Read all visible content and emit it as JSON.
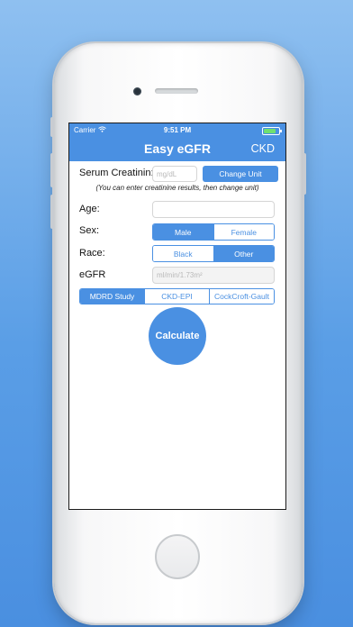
{
  "status_bar": {
    "carrier": "Carrier",
    "time": "9:51 PM"
  },
  "nav": {
    "title": "Easy eGFR",
    "right_button": "CKD"
  },
  "form": {
    "serum_creatinine": {
      "label": "Serum Creatinin:",
      "placeholder": "mg/dL",
      "change_unit": "Change Unit"
    },
    "note": "(You can enter creatinine results, then change unit)",
    "age": {
      "label": "Age:",
      "value": ""
    },
    "sex": {
      "label": "Sex:",
      "options": [
        "Male",
        "Female"
      ],
      "selected": "Male"
    },
    "race": {
      "label": "Race:",
      "options": [
        "Black",
        "Other"
      ],
      "selected": "Other"
    },
    "egfr": {
      "label": "eGFR",
      "placeholder": "ml/min/1.73m²"
    },
    "formulas": {
      "options": [
        "MDRD Study",
        "CKD-EPI",
        "CockCroft-Gault"
      ],
      "selected": "MDRD Study"
    },
    "calculate": "Calculate"
  },
  "colors": {
    "accent": "#4a90e2",
    "background": "#5a9ee6"
  }
}
